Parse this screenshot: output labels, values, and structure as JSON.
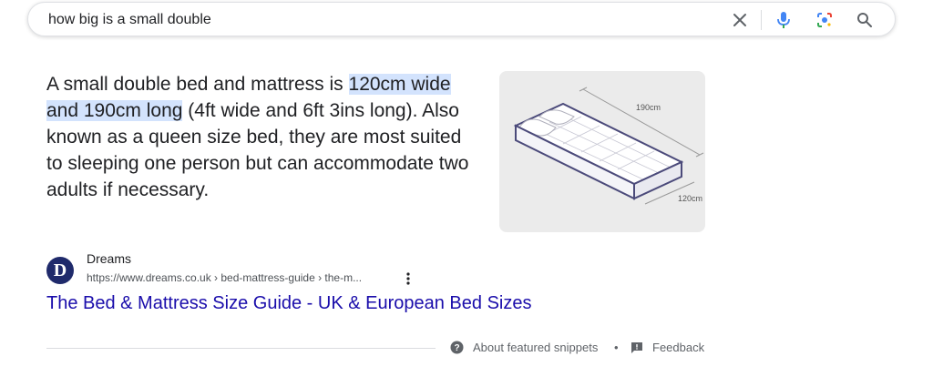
{
  "search": {
    "query": "how big is a small double"
  },
  "snippet": {
    "text_before": "A small double bed and mattress is ",
    "highlight": "120cm wide and 190cm long",
    "text_after": " (4ft wide and 6ft 3ins long). Also known as a queen size bed, they are most suited to sleeping one person but can accommodate two adults if necessary.",
    "image_labels": {
      "length": "190cm",
      "width": "120cm"
    }
  },
  "source": {
    "logo_letter": "D",
    "name": "Dreams",
    "url": "https://www.dreams.co.uk › bed-mattress-guide › the-m...",
    "title": "The Bed & Mattress Size Guide - UK & European Bed Sizes"
  },
  "footer": {
    "about_label": "About featured snippets",
    "separator": "•",
    "feedback_label": "Feedback"
  },
  "colors": {
    "link": "#1a0dab",
    "highlight": "#d3e3fd",
    "logo_bg": "#1f2a6b"
  }
}
